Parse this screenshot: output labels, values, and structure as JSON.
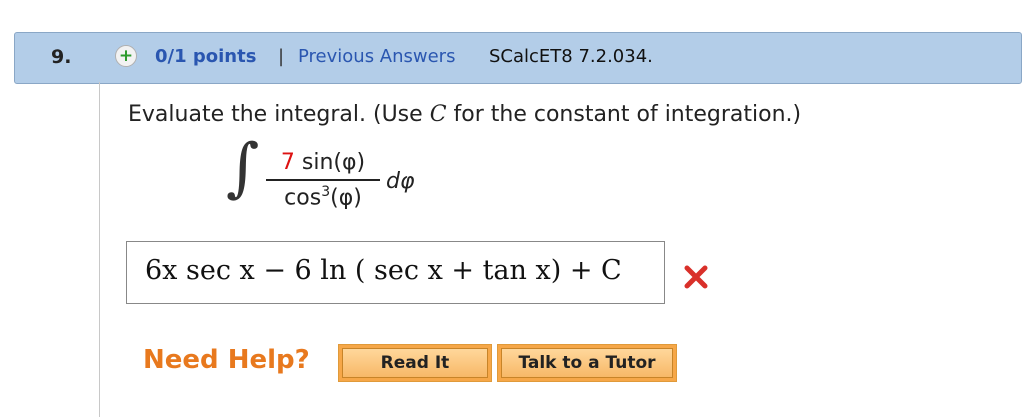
{
  "question": {
    "number": "9.",
    "points": "0/1 points",
    "separator": "|",
    "previous_answers": "Previous Answers",
    "code": "SCalcET8 7.2.034."
  },
  "prompt": {
    "before_c": "Evaluate the integral. (Use ",
    "c": "C",
    "after_c": " for the constant of integration.)"
  },
  "integral": {
    "symbol": "∫",
    "coefficient": "7",
    "numerator_rest": " sin(φ)",
    "denominator_base": "cos",
    "denominator_exp": "3",
    "denominator_rest": "(φ)",
    "differential": "dφ"
  },
  "answer": {
    "value": "6x sec x − 6 ln ( sec x + tan x) + C",
    "status": "incorrect"
  },
  "help": {
    "label": "Need Help?",
    "read_it": "Read It",
    "talk_to_tutor": "Talk to a Tutor"
  },
  "icons": {
    "plus": "plus-icon",
    "wrong": "x-mark-icon"
  },
  "colors": {
    "header_bg": "#b3cde8",
    "link": "#2a56b0",
    "wrong_red": "#d9302a",
    "help_orange": "#e8791e"
  }
}
